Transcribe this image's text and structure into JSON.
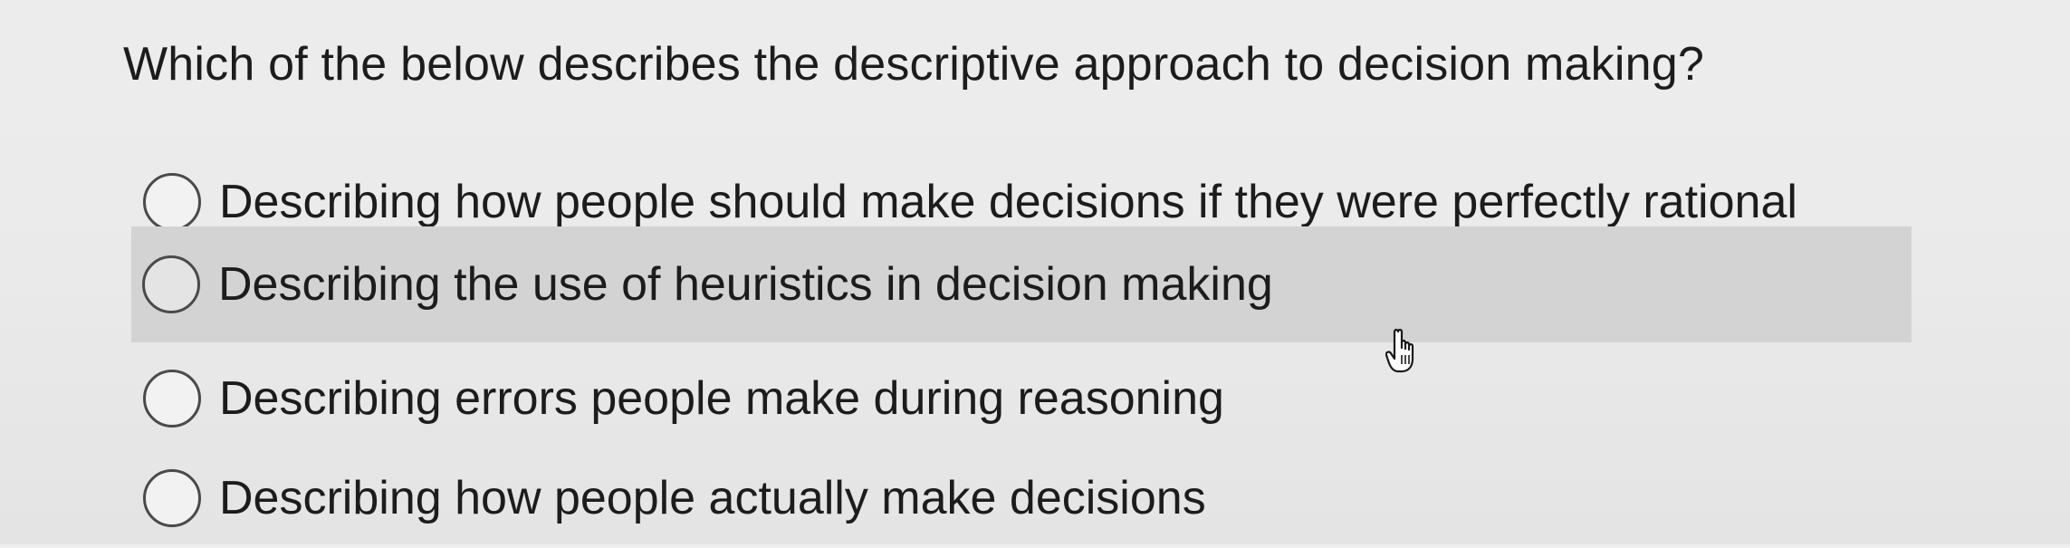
{
  "question": {
    "text": "Which of the below describes the descriptive approach to decision making?"
  },
  "options": [
    {
      "label": "Describing how people should make decisions if they were perfectly rational",
      "selected": false,
      "hovered": false
    },
    {
      "label": "Describing the use of heuristics in decision making",
      "selected": false,
      "hovered": true
    },
    {
      "label": "Describing errors people make during reasoning",
      "selected": false,
      "hovered": false
    },
    {
      "label": "Describing how people actually make decisions",
      "selected": false,
      "hovered": false
    }
  ],
  "cursor": {
    "icon": "hand-pointer-icon"
  },
  "colors": {
    "background": "#ebebeb",
    "hover_row": "#d3d3d3",
    "text": "#1c1c1c",
    "radio_border": "#4a4a4a"
  }
}
